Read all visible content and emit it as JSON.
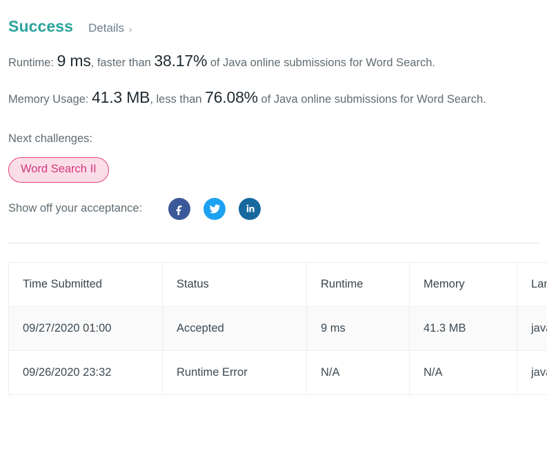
{
  "header": {
    "status": "Success",
    "details_label": "Details",
    "chevron": "›"
  },
  "stats": {
    "runtime": {
      "label": "Runtime:",
      "value": "9 ms",
      "mid_text": ", faster than",
      "percent": "38.17%",
      "suffix": "of Java online submissions for Word Search."
    },
    "memory": {
      "label": "Memory Usage:",
      "value": "41.3 MB",
      "mid_text": ", less than",
      "percent": "76.08%",
      "suffix": "of Java online submissions for Word Search."
    }
  },
  "next_challenges": {
    "label": "Next challenges:",
    "items": [
      {
        "label": "Word Search II"
      }
    ]
  },
  "share": {
    "label": "Show off your acceptance:",
    "icons": [
      {
        "name": "facebook-share-icon",
        "color": "#3b5998"
      },
      {
        "name": "twitter-share-icon",
        "color": "#1da1f2"
      },
      {
        "name": "linkedin-share-icon",
        "color": "#16689f"
      }
    ]
  },
  "submissions_table": {
    "columns": [
      "Time Submitted",
      "Status",
      "Runtime",
      "Memory",
      "Language"
    ],
    "rows": [
      {
        "time": "09/27/2020 01:00",
        "status": "Accepted",
        "status_color": "#00ad9b",
        "runtime": "9 ms",
        "memory": "41.3 MB",
        "language": "java"
      },
      {
        "time": "09/26/2020 23:32",
        "status": "Runtime Error",
        "status_color": "#c0392b",
        "runtime": "N/A",
        "memory": "N/A",
        "language": "java"
      }
    ]
  },
  "colors": {
    "success_teal": "#2ba39b",
    "accepted_teal": "#00ad9b",
    "error_red": "#c0392b",
    "pill_border": "#e5407a",
    "pill_bg": "#fbdde8",
    "pill_text": "#d6397c"
  }
}
